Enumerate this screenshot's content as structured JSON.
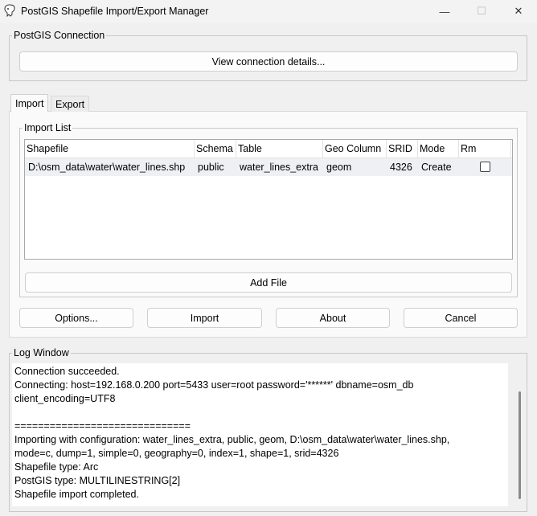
{
  "window": {
    "title": "PostGIS Shapefile Import/Export Manager",
    "minimize_glyph": "—",
    "maximize_glyph": "☐",
    "close_glyph": "✕"
  },
  "connection": {
    "legend": "PostGIS Connection",
    "button": "View connection details..."
  },
  "tabs": [
    {
      "label": "Import",
      "active": true
    },
    {
      "label": "Export",
      "active": false
    }
  ],
  "import_list": {
    "legend": "Import List",
    "columns": [
      "Shapefile",
      "Schema",
      "Table",
      "Geo Column",
      "SRID",
      "Mode",
      "Rm"
    ],
    "rows": [
      {
        "shapefile": "D:\\osm_data\\water\\water_lines.shp",
        "schema": "public",
        "table": "water_lines_extra",
        "geo_column": "geom",
        "srid": "4326",
        "mode": "Create",
        "rm": false
      }
    ],
    "add_file": "Add File"
  },
  "actions": {
    "options": "Options...",
    "import": "Import",
    "about": "About",
    "cancel": "Cancel"
  },
  "log": {
    "legend": "Log Window",
    "lines": [
      "Connection succeeded.",
      "Connecting:  host=192.168.0.200 port=5433 user=root password='******' dbname=osm_db",
      "client_encoding=UTF8",
      "",
      "==============================",
      "Importing with configuration: water_lines_extra, public, geom, D:\\osm_data\\water\\water_lines.shp,",
      "mode=c, dump=1, simple=0, geography=0, index=1, shape=1, srid=4326",
      "Shapefile type: Arc",
      "PostGIS type: MULTILINESTRING[2]",
      "Shapefile import completed."
    ]
  }
}
